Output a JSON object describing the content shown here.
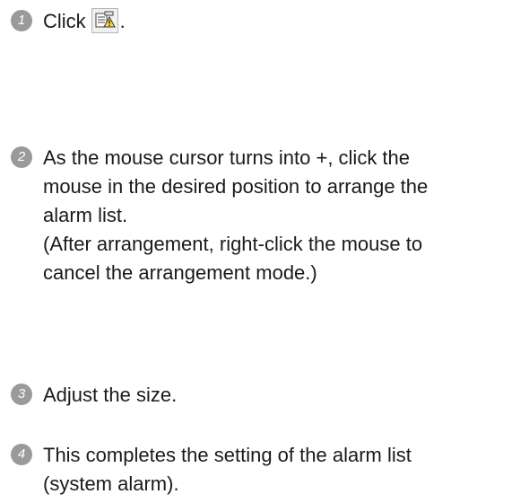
{
  "steps": [
    {
      "number": "1",
      "text_before": "Click",
      "text_after": "."
    },
    {
      "number": "2",
      "lines": [
        "As the mouse cursor turns into +, click the",
        "mouse in the desired position to arrange the",
        "alarm list.",
        "(After arrangement, right-click the mouse to",
        "cancel the arrangement mode.)"
      ]
    },
    {
      "number": "3",
      "text": "Adjust the size."
    },
    {
      "number": "4",
      "lines": [
        "This completes the setting of the alarm list",
        "(system alarm)."
      ]
    }
  ],
  "icons": {
    "step1": "alarm-list-tool-icon"
  }
}
